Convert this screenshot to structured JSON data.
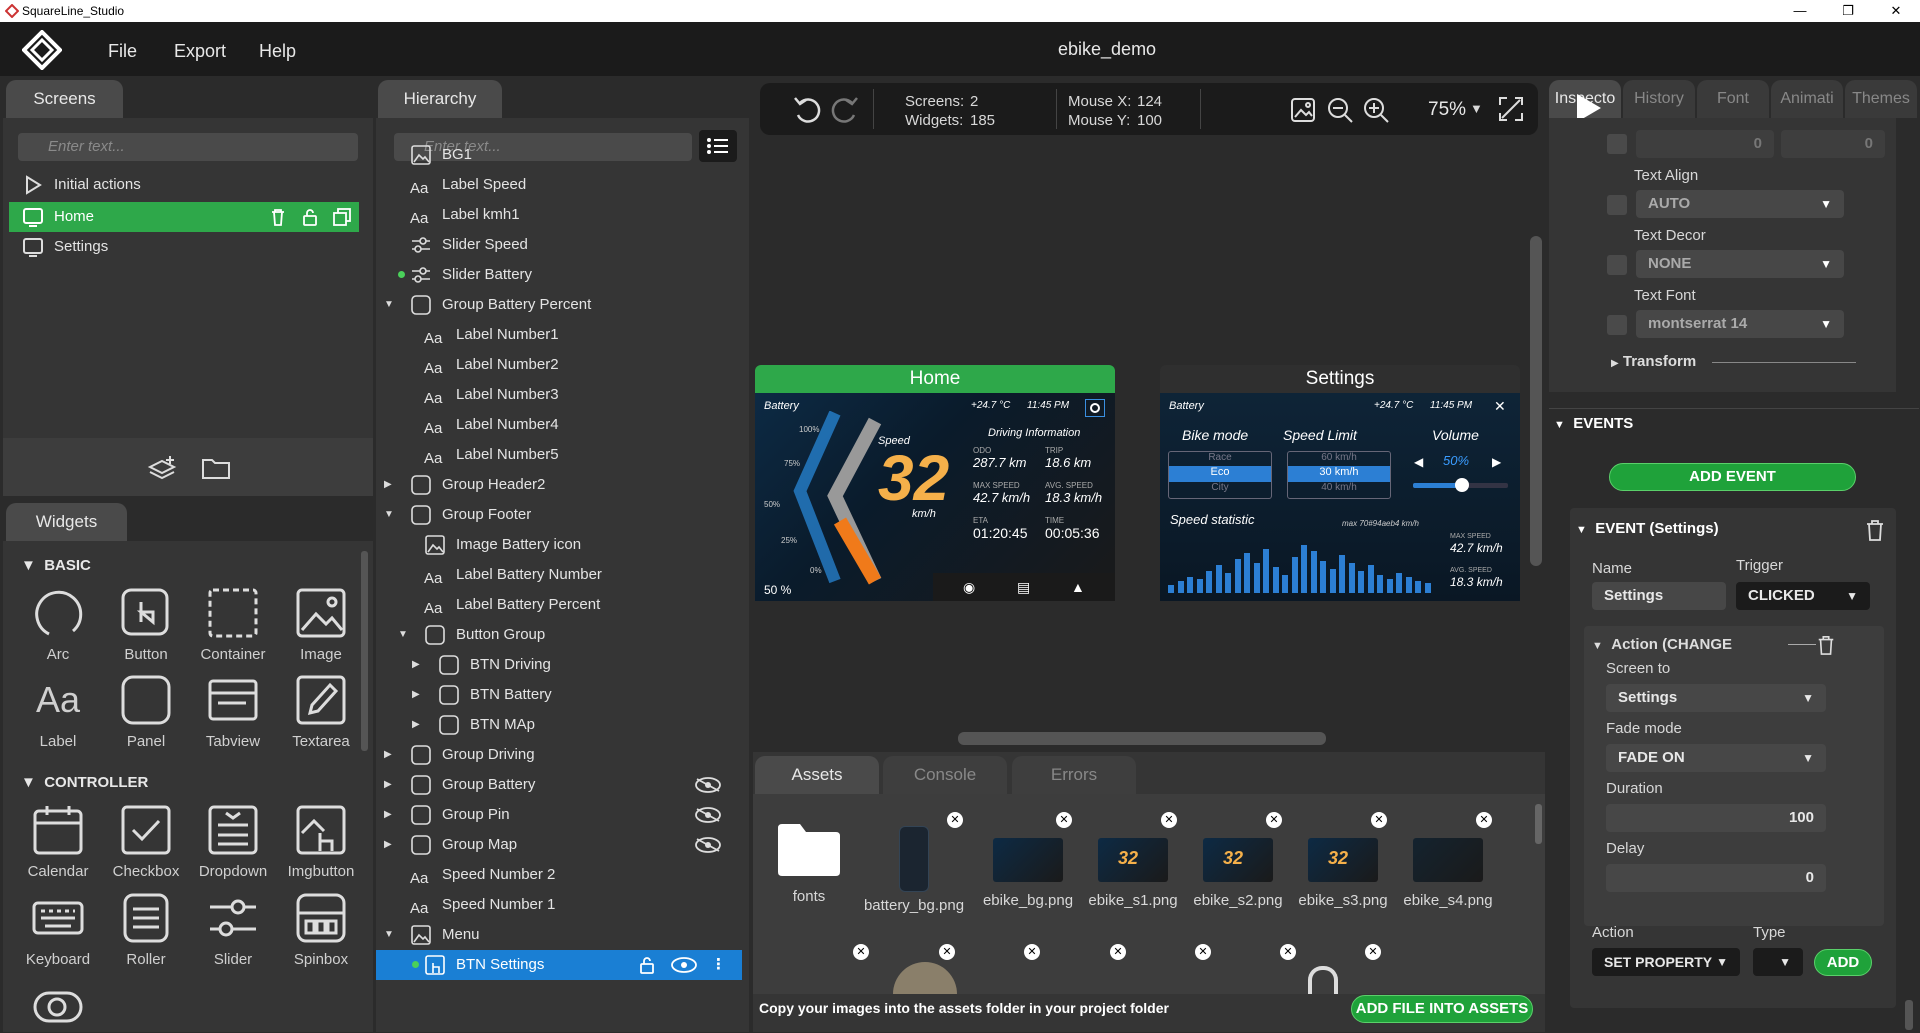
{
  "window": {
    "title": "SquareLine_Studio"
  },
  "menu": {
    "file": "File",
    "export": "Export",
    "help": "Help",
    "project": "ebike_demo"
  },
  "screens": {
    "tab": "Screens",
    "search_placeholder": "Enter text...",
    "items": [
      "Initial actions",
      "Home",
      "Settings"
    ]
  },
  "widgets": {
    "tab": "Widgets",
    "basic_title": "BASIC",
    "basic": [
      "Arc",
      "Button",
      "Container",
      "Image",
      "Label",
      "Panel",
      "Tabview",
      "Textarea"
    ],
    "controller_title": "CONTROLLER",
    "controller": [
      "Calendar",
      "Checkbox",
      "Dropdown",
      "Imgbutton",
      "Keyboard",
      "Roller",
      "Slider",
      "Spinbox"
    ]
  },
  "hierarchy": {
    "tab": "Hierarchy",
    "search_placeholder": "Enter text...",
    "items": [
      "BG1",
      "Label Speed",
      "Label kmh1",
      "Slider Speed",
      "Slider Battery",
      "Group Battery Percent",
      "Label Number1",
      "Label Number2",
      "Label Number3",
      "Label Number4",
      "Label Number5",
      "Group Header2",
      "Group Footer",
      "Image Battery icon",
      "Label Battery Number",
      "Label Battery Percent",
      "Button Group",
      "BTN Driving",
      "BTN Battery",
      "BTN MAp",
      "Group Driving",
      "Group Battery",
      "Group Pin",
      "Group Map",
      "Speed Number 2",
      "Speed Number 1",
      "Menu",
      "BTN Settings"
    ]
  },
  "toolbar": {
    "screens_label": "Screens:",
    "screens_value": "2",
    "widgets_label": "Widgets:",
    "widgets_value": "185",
    "mousex_label": "Mouse X:",
    "mousex_value": "124",
    "mousey_label": "Mouse Y:",
    "mousey_value": "100",
    "zoom": "75%"
  },
  "canvas": {
    "home_title": "Home",
    "settings_title": "Settings",
    "home": {
      "battery": "Battery",
      "temp": "+24.7 °C",
      "time": "11:45 PM",
      "info_title": "Driving Information",
      "speed_label": "Speed",
      "speed_value": "32",
      "speed_unit": "km/h",
      "odo_label": "ODO",
      "odo_value": "287.7 km",
      "trip_label": "TRIP",
      "trip_value": "18.6 km",
      "max_label": "MAX SPEED",
      "max_value": "42.7 km/h",
      "avg_label": "AVG. SPEED",
      "avg_value": "18.3 km/h",
      "eta_label": "ETA",
      "eta_value": "01:20:45",
      "time_label": "TIME",
      "time_value": "00:05:36",
      "scale": [
        "100%",
        "75%",
        "50%",
        "25%",
        "0%"
      ],
      "battery_pct": "50 %"
    },
    "settings": {
      "battery": "Battery",
      "temp": "+24.7 °C",
      "time": "11:45 PM",
      "bike_mode": "Bike mode",
      "modes": [
        "Race",
        "Eco",
        "City"
      ],
      "speed_limit": "Speed Limit",
      "limits": [
        "60 km/h",
        "30 km/h",
        "40 km/h"
      ],
      "volume": "Volume",
      "volume_value": "50%",
      "speed_stat": "Speed statistic",
      "max_hint": "max 70#94aeb4 km/h",
      "max_label": "MAX SPEED",
      "max_value": "42.7 km/h",
      "avg_label": "AVG. SPEED",
      "avg_value": "18.3 km/h"
    }
  },
  "bottom": {
    "tabs": [
      "Assets",
      "Console",
      "Errors"
    ],
    "assets": [
      "fonts",
      "battery_bg.png",
      "ebike_bg.png",
      "ebike_s1.png",
      "ebike_s2.png",
      "ebike_s3.png",
      "ebike_s4.png"
    ],
    "hint": "Copy your images into the assets folder in your project folder",
    "add_file": "ADD FILE INTO ASSETS"
  },
  "inspector": {
    "tabs": [
      "Inspecto",
      "History",
      "Font",
      "Animati",
      "Themes"
    ],
    "num_a": "0",
    "num_b": "0",
    "text_align_label": "Text Align",
    "text_align": "AUTO",
    "text_decor_label": "Text Decor",
    "text_decor": "NONE",
    "text_font_label": "Text Font",
    "text_font": "montserrat 14",
    "transform": "Transform",
    "events_title": "EVENTS",
    "add_event": "ADD EVENT",
    "event_title": "EVENT (Settings)",
    "name_label": "Name",
    "name_value": "Settings",
    "trigger_label": "Trigger",
    "trigger_value": "CLICKED",
    "action_title": "Action (CHANGE",
    "screen_to_label": "Screen to",
    "screen_to": "Settings",
    "fade_label": "Fade mode",
    "fade_value": "FADE ON",
    "duration_label": "Duration",
    "duration_value": "100",
    "delay_label": "Delay",
    "delay_value": "0",
    "action_label": "Action",
    "action_value": "SET PROPERTY",
    "type_label": "Type",
    "add": "ADD"
  },
  "colors": {
    "accent": "#2ea84a",
    "selected": "#1a7fd4",
    "dark": "#1b1b1b"
  }
}
